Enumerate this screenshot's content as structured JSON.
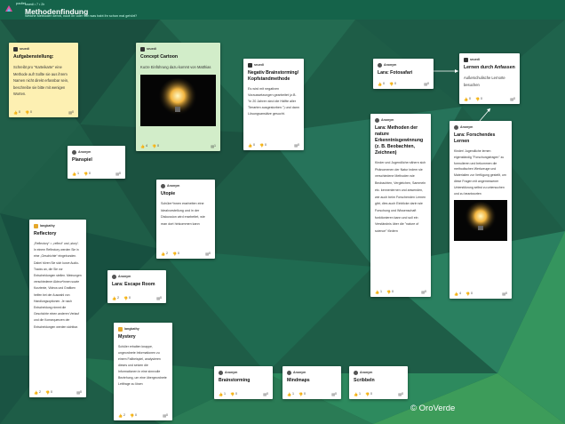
{
  "app": {
    "name": "padlet"
  },
  "pad": {
    "meta": "sruedi  •  7  •  2h",
    "title": "Methodenfindung",
    "subtitle": "Welche Methoden kennt, nutzt ihr oder von was habt ihr schon mal gehört?"
  },
  "cards": {
    "aufgabe": {
      "author": "sruedi",
      "title": "Aufgabenstellung:",
      "text": "Schreibt pro \"Karteikarte\" eine Methode auf! Sollte sie aus ihrem Namen nicht direkt erfassbar sein, beschreibe sie bitte mit wenigen Worten.",
      "likes": "0",
      "dislikes": "0",
      "comments": "0"
    },
    "concept": {
      "author": "sruedi",
      "title": "Concept Cartoon",
      "text": "Kurze Einführung dazu kommt von Matthias",
      "likes": "4",
      "dislikes": "0",
      "comments": "1"
    },
    "negativ": {
      "author": "sruedi",
      "title": "Negativ Brainstorming/ Kopfstandmethode",
      "text": "Es wird mit negativen Voraussetzungen gearbeitet (z.B. \"in 20 Jahren sind die Hälfte aller Tierarten ausgestorben.\") und dann Lösungsansätze gesucht.",
      "likes": "0",
      "dislikes": "0",
      "comments": "0"
    },
    "fotosafari": {
      "author": "Anonym",
      "title": "Lara: Fotosafari",
      "likes": "0",
      "dislikes": "0",
      "comments": "0"
    },
    "anfassen": {
      "author": "sruedi",
      "title": "Lernen durch Anfassen",
      "text": "Außerschulische Lernorte besuchen",
      "likes": "0",
      "dislikes": "0",
      "comments": "0"
    },
    "planspiel": {
      "author": "Anonym",
      "title": "Planspiel",
      "likes": "1",
      "dislikes": "0",
      "comments": "0"
    },
    "utopie": {
      "author": "Anonym",
      "title": "Utopie",
      "text": "Schüler*innen erarbeiten eine Idealvorstellung und in der Diskussion wird erarbeitet, wie man dort hinkommen kann",
      "likes": "2",
      "dislikes": "0",
      "comments": "0"
    },
    "natur": {
      "author": "Anonym",
      "title": "Lara: Methoden der nature Erkenntnisgewinnung (z. B. Beobachten, Zeichnen)",
      "text": "Kinder und Jugendliche nähern sich Phänomenen der Natur indem sie verschiedene Methoden wie Beobachten, Vergleichen, Sammeln etc. kennenlernen und anwenden, wie auch beim Forschenden Lernen gibt, dies auch Einblicke darin wie Forschung und Wissenschaft funktionieren kann und soll ein Verständnis über die \"nature of science\" fördern",
      "likes": "1",
      "dislikes": "0",
      "comments": "0"
    },
    "forschend": {
      "author": "Anonym",
      "title": "Lara: Forschendes Lernen",
      "text": "Kinder/ Jugendliche lernen eigenständig \"Forschungsfragen\" zu formulieren und bekommen die methodischen Werkzeuge und Materialien zur Verfügung gestellt, um diese Fragen mit angemessener Unterstützung selbst zu untersuchen und zu beantworten",
      "likes": "4",
      "dislikes": "0",
      "comments": "0"
    },
    "reflectory": {
      "author": "langkathy",
      "title": "Reflectory",
      "text": "„Reflectory“ = „reflect“ und „story“. In einem Reflectory werden Sie in eine „Geschichte“ eingebunden. Dabei hören Sie sich kurze Audio-Tracks an, die Sie vor Entscheidungen stellen. Meinungen verschiedener Akteur*innen sowie Kurztexte, Videos und Grafiken helfen bei der Auswahl von Handlungsoptionen. Je nach Entscheidung nimmt die Geschichte einen anderen Verlauf und die Konsequenzen der Entscheidungen werden sichtbar.",
      "likes": "2",
      "dislikes": "0",
      "comments": "0"
    },
    "escape": {
      "author": "Anonym",
      "title": "Lara: Escape Room",
      "likes": "2",
      "dislikes": "0",
      "comments": "0"
    },
    "mystery": {
      "author": "langkathy",
      "title": "Mystery",
      "text": "Schüler erhalten knappe, ungeordnete Informationen zu einem Fallbeispiel, analysieren dieses und setzen die Informationen in eine sinnvolle Beziehung, um eine übergeordnete Leitfrage zu lösen",
      "likes": "2",
      "dislikes": "0",
      "comments": "0"
    },
    "brainstorming": {
      "author": "Anonym",
      "title": "Brainstorming",
      "likes": "1",
      "dislikes": "0",
      "comments": "0"
    },
    "mindmaps": {
      "author": "Anonym",
      "title": "Mindmaps",
      "likes": "1",
      "dislikes": "0",
      "comments": "0"
    },
    "scribbeln": {
      "author": "Anonym",
      "title": "Scribbeln",
      "likes": "1",
      "dislikes": "0",
      "comments": "0"
    }
  },
  "icons": {
    "like": "thumbs-up-icon",
    "dislike": "thumbs-down-icon",
    "comment": "comment-icon"
  },
  "colors": {
    "header": "#15634a",
    "yellow_card": "#fdf0b2",
    "green_card": "#d2edc9"
  },
  "copyright": "© OroVerde"
}
